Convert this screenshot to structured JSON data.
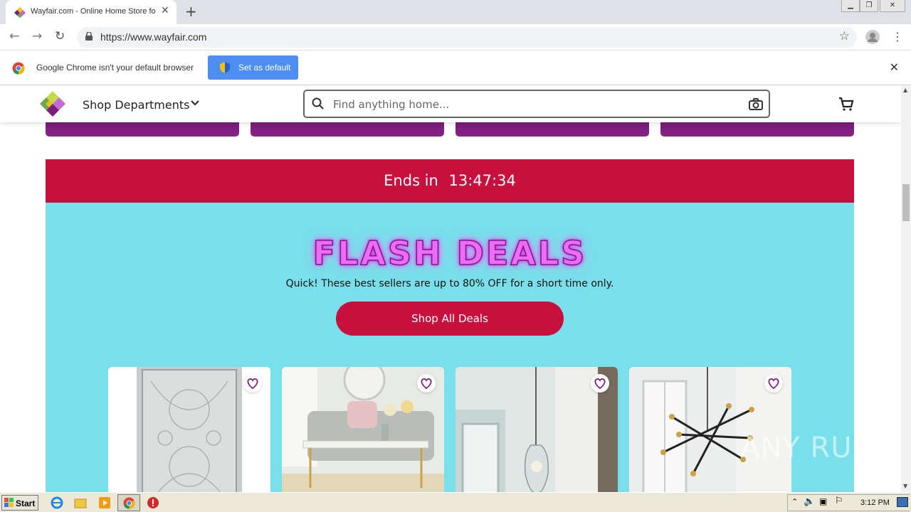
{
  "browser": {
    "tab_title": "Wayfair.com - Online Home Store for",
    "url": "https://www.wayfair.com",
    "infobar_message": "Google Chrome isn't your default browser",
    "infobar_button": "Set as default"
  },
  "site": {
    "nav_label": "Shop Departments",
    "search_placeholder": "Find anything home...",
    "countdown_prefix": "Ends in",
    "countdown_time": "13:47:34",
    "flash_title": "FLASH DEALS",
    "flash_subtitle": "Quick! These best sellers are up to 80% OFF for a short time only.",
    "shop_all_label": "Shop All Deals",
    "colors": {
      "brand_purple": "#7b1f7f",
      "deal_red": "#c8103f",
      "deal_bg": "#79dfeb"
    }
  },
  "taskbar": {
    "start_label": "Start",
    "clock": "3:12 PM"
  },
  "watermark": "ANY RUN"
}
